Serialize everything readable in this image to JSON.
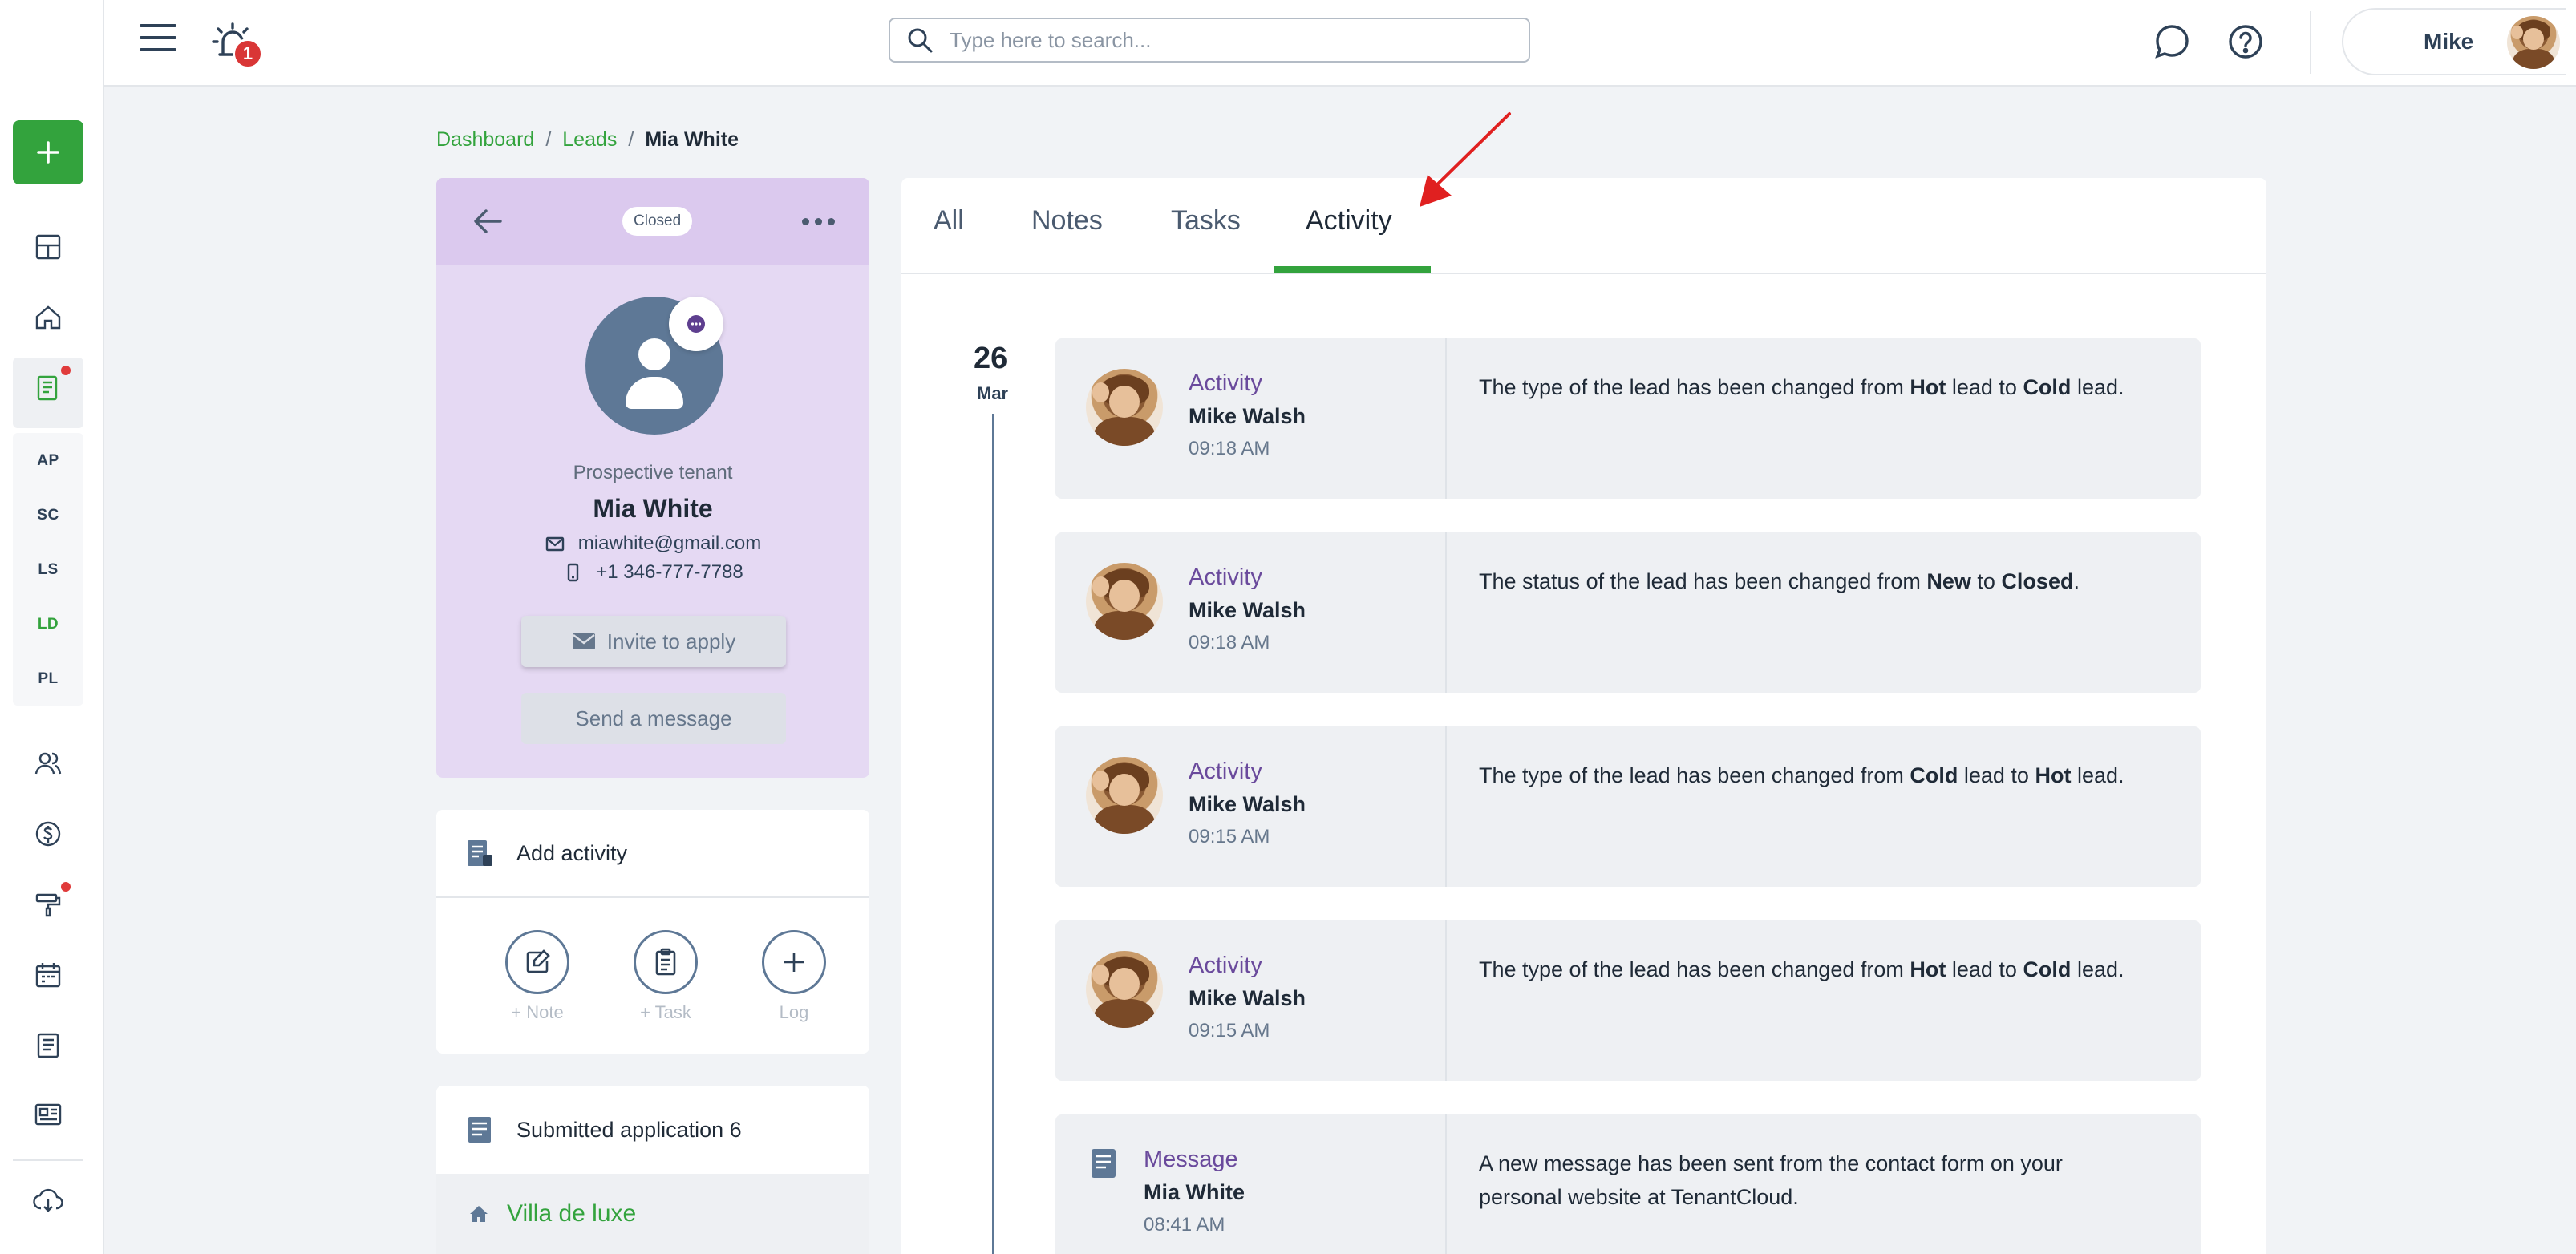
{
  "sidebar": {
    "add_button": "+",
    "abbrs": [
      "AP",
      "SC",
      "LS",
      "LD",
      "PL"
    ],
    "active_abbr": "LD",
    "icons": [
      "dashboard-icon",
      "home-icon",
      "leads-icon",
      "contacts-icon",
      "dollar-icon",
      "paint-roller-icon",
      "calendar-icon",
      "document-icon",
      "newspaper-icon",
      "download-cloud-icon"
    ]
  },
  "topbar": {
    "notifications_count": "1",
    "search_placeholder": "Type here to search...",
    "user_name": "Mike"
  },
  "breadcrumb": {
    "items": [
      "Dashboard",
      "Leads",
      "Mia White"
    ],
    "separator": "/"
  },
  "contact": {
    "status": "Closed",
    "role": "Prospective tenant",
    "name": "Mia White",
    "email": "miawhite@gmail.com",
    "phone": "+1 346-777-7788",
    "invite_label": "Invite to apply",
    "send_label": "Send a message"
  },
  "add_activity": {
    "title": "Add activity",
    "options": [
      "+ Note",
      "+ Task",
      "Log"
    ]
  },
  "submitted": {
    "title": "Submitted application 6",
    "property": "Villa de luxe"
  },
  "tabs": [
    "All",
    "Notes",
    "Tasks",
    "Activity"
  ],
  "active_tab": "Activity",
  "timeline": {
    "day": "26",
    "month": "Mar",
    "entries": [
      {
        "kind": "Activity",
        "who": "Mike Walsh",
        "time": "09:18 AM",
        "pre": "The type of the lead has been changed from ",
        "b1": "Hot",
        "mid": " lead to ",
        "b2": "Cold",
        "post": " lead."
      },
      {
        "kind": "Activity",
        "who": "Mike Walsh",
        "time": "09:18 AM",
        "pre": "The status of the lead has been changed from ",
        "b1": "New",
        "mid": " to ",
        "b2": "Closed",
        "post": "."
      },
      {
        "kind": "Activity",
        "who": "Mike Walsh",
        "time": "09:15 AM",
        "pre": "The type of the lead has been changed from ",
        "b1": "Cold",
        "mid": " lead to ",
        "b2": "Hot",
        "post": " lead."
      },
      {
        "kind": "Activity",
        "who": "Mike Walsh",
        "time": "09:15 AM",
        "pre": "The type of the lead has been changed from ",
        "b1": "Hot",
        "mid": " lead to ",
        "b2": "Cold",
        "post": " lead."
      },
      {
        "kind": "Message",
        "who": "Mia White",
        "time": "08:41 AM",
        "text": "A new message has been sent from the contact form on your personal website at TenantCloud."
      }
    ]
  },
  "colors": {
    "accent_green": "#33a33d",
    "activity_purple": "#6a4a9c",
    "contact_card_bg": "#e5d9f3",
    "annotation_red": "#e02020"
  }
}
